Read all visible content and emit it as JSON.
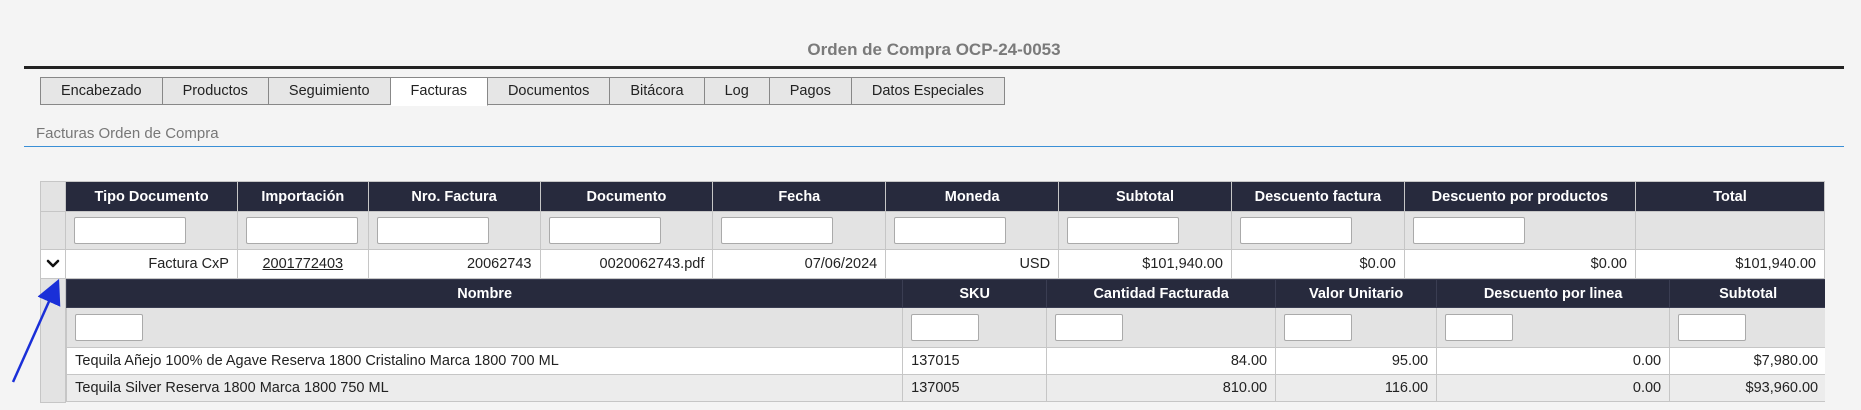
{
  "page": {
    "title": "Orden de Compra OCP-24-0053"
  },
  "tabs": [
    {
      "label": "Encabezado",
      "active": false
    },
    {
      "label": "Productos",
      "active": false
    },
    {
      "label": "Seguimiento",
      "active": false
    },
    {
      "label": "Facturas",
      "active": true
    },
    {
      "label": "Documentos",
      "active": false
    },
    {
      "label": "Bitácora",
      "active": false
    },
    {
      "label": "Log",
      "active": false
    },
    {
      "label": "Pagos",
      "active": false
    },
    {
      "label": "Datos Especiales",
      "active": false
    }
  ],
  "section": {
    "label": "Facturas Orden de Compra"
  },
  "invoices": {
    "columns": [
      "Tipo Documento",
      "Importación",
      "Nro. Factura",
      "Documento",
      "Fecha",
      "Moneda",
      "Subtotal",
      "Descuento factura",
      "Descuento por productos",
      "Total"
    ],
    "rows": [
      {
        "tipo": "Factura CxP",
        "importacion": "2001772403",
        "nro": "20062743",
        "documento": "0020062743.pdf",
        "fecha": "07/06/2024",
        "moneda": "USD",
        "subtotal": "$101,940.00",
        "desc_factura": "$0.00",
        "desc_productos": "$0.00",
        "total": "$101,940.00"
      }
    ]
  },
  "details": {
    "columns": [
      "Nombre",
      "SKU",
      "Cantidad Facturada",
      "Valor Unitario",
      "Descuento por linea",
      "Subtotal"
    ],
    "rows": [
      {
        "nombre": "Tequila Añejo 100% de Agave Reserva 1800 Cristalino Marca 1800 700 ML",
        "sku": "137015",
        "cantidad": "84.00",
        "valor": "95.00",
        "descuento": "0.00",
        "subtotal": "$7,980.00"
      },
      {
        "nombre": "Tequila Silver Reserva 1800 Marca 1800 750 ML",
        "sku": "137005",
        "cantidad": "810.00",
        "valor": "116.00",
        "descuento": "0.00",
        "subtotal": "$93,960.00"
      }
    ]
  },
  "icons": {
    "expand": "chevron-down-icon",
    "annotation": "arrow-annotation"
  },
  "colors": {
    "header_bg": "#272a3d",
    "accent_rule": "#3a8fd6",
    "arrow": "#1a2fd8"
  }
}
